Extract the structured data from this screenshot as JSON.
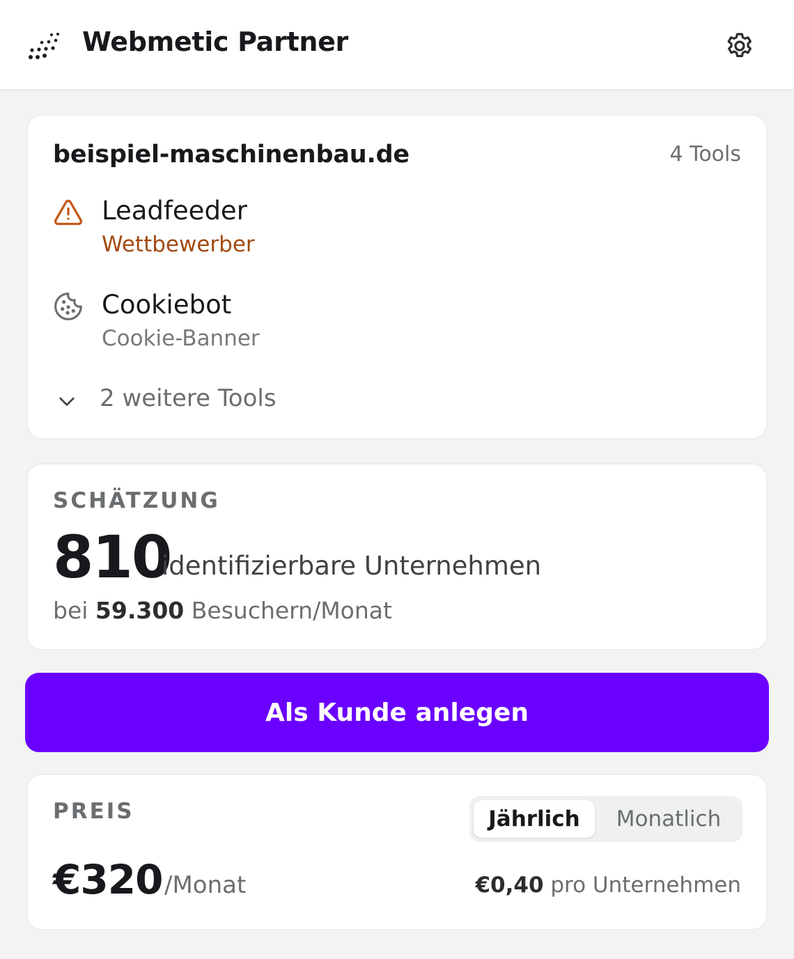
{
  "header": {
    "title": "Webmetic Partner",
    "logo_icon": "dot-grid-logo",
    "settings_icon": "gear-icon"
  },
  "tools_card": {
    "domain": "beispiel-maschinenbau.de",
    "tool_count": "4 Tools",
    "tools": [
      {
        "name": "Leadfeeder",
        "category": "Wettbewerber",
        "icon": "warning-triangle-icon",
        "color": "#a24a0f"
      },
      {
        "name": "Cookiebot",
        "category": "Cookie-Banner",
        "icon": "cookie-icon"
      }
    ],
    "more_label": "2 weitere Tools"
  },
  "estimate_card": {
    "label": "SCHÄTZUNG",
    "companies": "810",
    "companies_label": "identifizierbare Unternehmen",
    "visitors_prefix": "bei",
    "visitors": "59.300",
    "visitors_suffix": "Besuchern/Monat"
  },
  "cta": {
    "label": "Als Kunde anlegen",
    "color": "#6a00ff"
  },
  "price_card": {
    "label": "PREIS",
    "billing_options": [
      "Jährlich",
      "Monatlich"
    ],
    "selected_billing": "Jährlich",
    "amount": "€320",
    "period": "/Monat",
    "per_company_amount": "€0,40",
    "per_company_label": "pro Unternehmen"
  }
}
